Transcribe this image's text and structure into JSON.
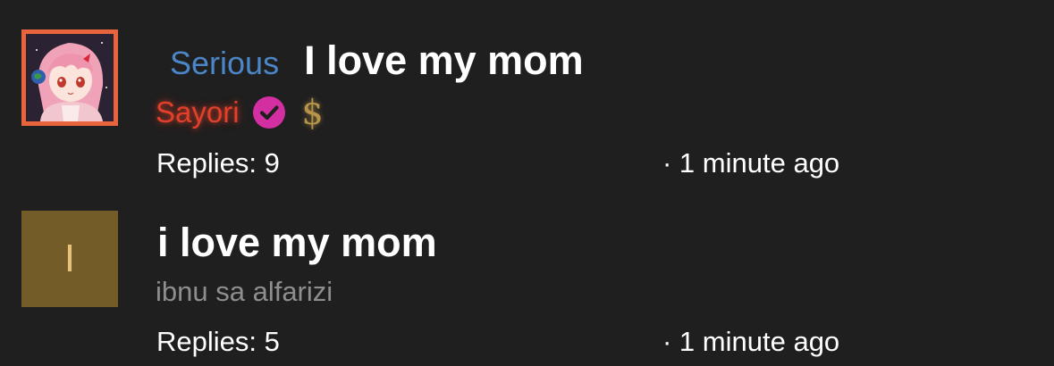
{
  "threads": [
    {
      "tag": "Serious",
      "title": "I love my mom",
      "author": "Sayori",
      "author_color": "#e2402a",
      "avatar_border_color": "#e8643c",
      "verified_icon": "verified-check-icon",
      "verified_color": "#d42ea3",
      "donor_icon": "dollar-icon",
      "donor_symbol": "$",
      "replies": "Replies: 9",
      "time": "· 1 minute ago"
    },
    {
      "initial": "I",
      "avatar_color": "#745c29",
      "title": "i love my mom",
      "author": "ibnu sa alfarizi",
      "replies": "Replies: 5",
      "time": "· 1 minute ago"
    }
  ]
}
